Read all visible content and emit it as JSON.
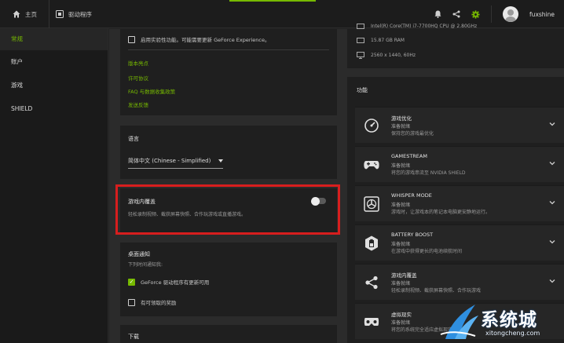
{
  "topbar": {
    "home_label": "主页",
    "drivers_label": "驱动程序",
    "username": "fuxshine",
    "accent_color": "#76b900"
  },
  "sidebar": {
    "items": [
      {
        "label": "常规",
        "active": true
      },
      {
        "label": "账户",
        "active": false
      },
      {
        "label": "游戏",
        "active": false
      },
      {
        "label": "SHIELD",
        "active": false
      }
    ]
  },
  "general": {
    "experimental_label": "启用实验性功能。可能需要更新 GeForce Experience。",
    "links": [
      "版本亮点",
      "许可协议",
      "FAQ 与数据收集政策",
      "发送反馈"
    ]
  },
  "language": {
    "title": "语言",
    "selected": "简体中文 (Chinese - Simplified)"
  },
  "overlay": {
    "title": "游戏内覆盖",
    "description": "轻松录制视频、截获屏幕快照、合作玩游戏或直播游戏。",
    "enabled": false
  },
  "notifications": {
    "title": "桌面通知",
    "subtitle": "下列时间通知我:",
    "options": [
      {
        "label": "GeForce 驱动程序有更新可用",
        "checked": true
      },
      {
        "label": "有可领取的奖励",
        "checked": false
      }
    ]
  },
  "download": {
    "title": "下载"
  },
  "system": {
    "cpu": "Intel(R) Core(TM) i7-7700HQ CPU @ 2.80GHz",
    "ram": "15.87 GB RAM",
    "display": "2560 x 1440, 60Hz"
  },
  "features": {
    "heading": "功能",
    "items": [
      {
        "icon": "speedometer-icon",
        "title": "游戏优化",
        "status": "准备就绪",
        "desc": "保持您的游戏最优化"
      },
      {
        "icon": "gamepad-icon",
        "title": "GAMESTREAM",
        "status": "准备就绪",
        "desc": "将您的游戏串流至 NVIDIA SHIELD"
      },
      {
        "icon": "fan-icon",
        "title": "WHISPER MODE",
        "status": "准备就绪",
        "desc": "游戏时，让游戏本的笔记本电脑更安静地运行。"
      },
      {
        "icon": "battery-icon",
        "title": "BATTERY BOOST",
        "status": "准备就绪",
        "desc": "在游戏中获得更长的电池续航时间"
      },
      {
        "icon": "share-icon",
        "title": "游戏内覆盖",
        "status": "准备就绪",
        "desc": "轻松录制视频、截获屏幕快照、合作玩游戏"
      },
      {
        "icon": "vr-icon",
        "title": "虚拟现实",
        "status": "准备就绪",
        "desc": "将您的系统完全适应虚拟现实"
      }
    ]
  },
  "watermark": {
    "text": "系统城",
    "url": "xitongcheng.com"
  }
}
